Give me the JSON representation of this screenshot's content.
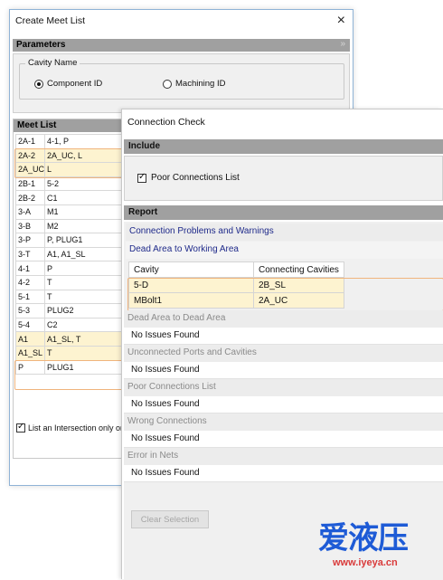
{
  "create_meet_list": {
    "title": "Create Meet List",
    "close_glyph": "×",
    "parameters": {
      "heading": "Parameters",
      "collapse_glyph": "»",
      "cavity_name_legend": "Cavity Name",
      "options": [
        {
          "label": "Component ID",
          "selected": true
        },
        {
          "label": "Machining ID",
          "selected": false
        }
      ]
    },
    "meet_list": {
      "heading": "Meet List",
      "rows": [
        [
          "2A-1",
          "4-1, P"
        ],
        [
          "2A-2",
          "2A_UC, L"
        ],
        [
          "2A_UC",
          "L"
        ],
        [
          "2B-1",
          "5-2"
        ],
        [
          "2B-2",
          "C1"
        ],
        [
          "3-A",
          "M1"
        ],
        [
          "3-B",
          "M2"
        ],
        [
          "3-P",
          "P, PLUG1"
        ],
        [
          "3-T",
          "A1, A1_SL"
        ],
        [
          "4-1",
          "P"
        ],
        [
          "4-2",
          "T"
        ],
        [
          "5-1",
          "T"
        ],
        [
          "5-3",
          "PLUG2"
        ],
        [
          "5-4",
          "C2"
        ],
        [
          "A1",
          "A1_SL, T"
        ],
        [
          "A1_SL",
          "T"
        ],
        [
          "P",
          "PLUG1"
        ]
      ]
    },
    "intersection_checkbox": {
      "label": "List an Intersection only once",
      "checked": true
    }
  },
  "connection_check": {
    "title": "Connection Check",
    "include": {
      "heading": "Include",
      "poor_connections_list": {
        "label": "Poor Connections List",
        "checked": true
      }
    },
    "report": {
      "heading": "Report",
      "problems_label": "Connection Problems and Warnings",
      "dead_to_working_label": "Dead Area to Working Area",
      "table": {
        "headers": [
          "Cavity",
          "Connecting Cavities"
        ],
        "rows": [
          [
            "5-D",
            "2B_SL"
          ],
          [
            "MBolt1",
            "2A_UC"
          ]
        ]
      },
      "sections": [
        {
          "label": "Dead Area to Dead Area",
          "value": "No Issues Found"
        },
        {
          "label": "Unconnected Ports and Cavities",
          "value": "No Issues Found"
        },
        {
          "label": "Poor Connections List",
          "value": "No Issues Found"
        },
        {
          "label": "Wrong Connections",
          "value": "No Issues Found"
        },
        {
          "label": "Error in Nets",
          "value": "No Issues Found"
        }
      ]
    },
    "clear_selection_label": "Clear Selection"
  },
  "watermark": {
    "brand": "爱液压",
    "url": "www.iyeya.cn"
  }
}
